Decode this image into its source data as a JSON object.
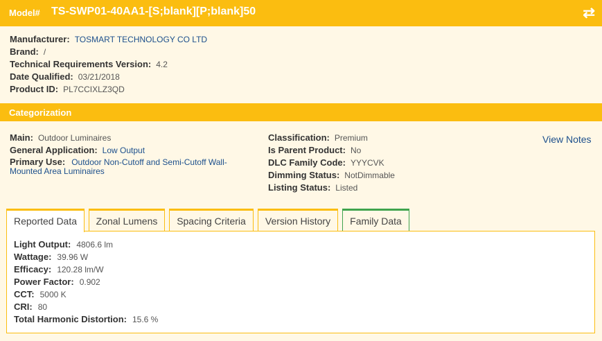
{
  "header": {
    "model_label": "Model#",
    "model_value": "TS-SWP01-40AA1-[S;blank][P;blank]50",
    "swap_icon": "⇄"
  },
  "details": {
    "manufacturer_label": "Manufacturer:",
    "manufacturer": "TOSMART TECHNOLOGY CO LTD",
    "brand_label": "Brand:",
    "brand": "/",
    "tech_req_label": "Technical Requirements Version:",
    "tech_req": "4.2",
    "date_label": "Date Qualified:",
    "date": "03/21/2018",
    "product_id_label": "Product ID:",
    "product_id": "PL7CCIXLZ3QD"
  },
  "categorization": {
    "title": "Categorization",
    "main_label": "Main:",
    "main": "Outdoor Luminaires",
    "general_app_label": "General Application:",
    "general_app": "Low Output",
    "primary_use_label": "Primary Use:",
    "primary_use": "Outdoor Non-Cutoff and Semi-Cutoff Wall-Mounted Area Luminaires",
    "classification_label": "Classification:",
    "classification": "Premium",
    "is_parent_label": "Is Parent Product:",
    "is_parent": "No",
    "family_code_label": "DLC Family Code:",
    "family_code": "YYYCVK",
    "dimming_label": "Dimming Status:",
    "dimming": "NotDimmable",
    "listing_label": "Listing Status:",
    "listing": "Listed",
    "view_notes": "View Notes"
  },
  "tabs": [
    {
      "label": "Reported Data"
    },
    {
      "label": "Zonal Lumens"
    },
    {
      "label": "Spacing Criteria"
    },
    {
      "label": "Version History"
    },
    {
      "label": "Family Data"
    }
  ],
  "reported": {
    "light_output_label": "Light Output:",
    "light_output": "4806.6 lm",
    "wattage_label": "Wattage:",
    "wattage": "39.96 W",
    "efficacy_label": "Efficacy:",
    "efficacy": "120.28 lm/W",
    "power_factor_label": "Power Factor:",
    "power_factor": "0.902",
    "cct_label": "CCT:",
    "cct": "5000 K",
    "cri_label": "CRI:",
    "cri": "80",
    "thd_label": "Total Harmonic Distortion:",
    "thd": "15.6 %"
  },
  "colors": {
    "accent": "#fbbd10",
    "background": "#fff8e6",
    "link": "#1c4f8c",
    "family_tab": "#3fa34d"
  }
}
